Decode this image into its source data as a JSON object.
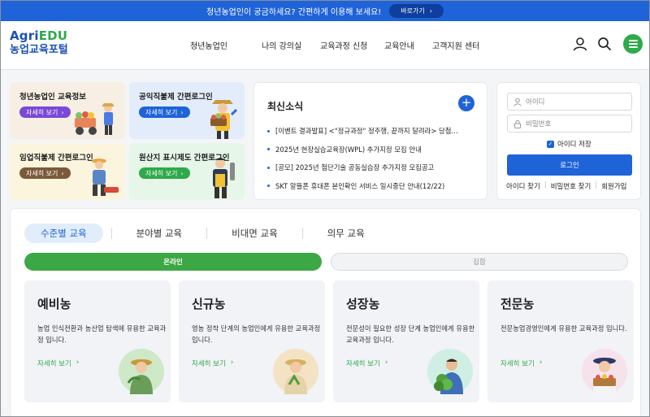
{
  "banner": {
    "text": "청년농업인이 궁금하세요? 간편하게 이용해 보세요!",
    "button": "바로가기",
    "button_icon": "chevron-right-icon"
  },
  "logo": {
    "line1_a": "Agri",
    "line1_b": "EDU",
    "line2": "농업교육포털"
  },
  "nav": [
    "청년농업인",
    "나의 강의실",
    "교육과정 신청",
    "교육안내",
    "고객지원 센터"
  ],
  "header_icons": [
    "user-icon",
    "search-icon",
    "menu-icon"
  ],
  "tiles": [
    {
      "title": "청년농업인 교육정보",
      "button": "자세히 보기",
      "bg": "#f7efe4",
      "btn_color": "#7a49d6"
    },
    {
      "title": "공익직불제 간편로그인",
      "button": "자세히 보기",
      "bg": "#e3ecfb",
      "btn_color": "#1f63d8"
    },
    {
      "title": "임업직불제 간편로그인",
      "button": "자세히 보기",
      "bg": "#fbf5dd",
      "btn_color": "#7b5a3a"
    },
    {
      "title": "원산지 표시제도 간편로그인",
      "button": "자세히 보기",
      "bg": "#e6f6e8",
      "btn_color": "#2eaa4a"
    }
  ],
  "news": {
    "title": "최신소식",
    "more": "+",
    "items": [
      "[이벤트 결과발표] <\"정규과정\" 정주행, 끝까지 달려라> 당첨…",
      "2025년 현장실습교육장(WPL) 추가지정 모집 안내",
      "[공모] 2025년 첨단기술 공동실습장 추가지정 모집공고",
      "SKT 알뜰폰 휴대폰 본인확인 서비스 일시중단 안내(12/22)"
    ]
  },
  "login": {
    "id_placeholder": "아이디",
    "pw_placeholder": "비밀번호",
    "save_id": "아이디 저장",
    "save_id_checked": true,
    "login_button": "로그인",
    "links": [
      "아이디 찾기",
      "비밀번호 찾기",
      "회원가입"
    ]
  },
  "courses": {
    "tabs": [
      "수준별 교육",
      "분야별 교육",
      "비대면 교육",
      "의무 교육"
    ],
    "active_tab": "수준별 교육",
    "modes": [
      "온라인",
      "집합"
    ],
    "active_mode": "온라인",
    "cards": [
      {
        "title": "예비농",
        "desc": "농업 인식전환과 농산업 탐색에 유용한 교육과정 입니다.",
        "more": "자세히 보기"
      },
      {
        "title": "신규농",
        "desc": "영농 정착 단계의 농업인에게 유용한 교육과정 입니다.",
        "more": "자세히 보기"
      },
      {
        "title": "성장농",
        "desc": "전문성이 필요한 성장 단계 농업인에게 유용한 교육과정 입니다.",
        "more": "자세히 보기"
      },
      {
        "title": "전문농",
        "desc": "전문농업경영인에게 유용한 교육과정 입니다.",
        "more": "자세히 보기"
      }
    ]
  },
  "colors": {
    "primary": "#1f63d8",
    "green": "#2eaa4a",
    "online_green": "#3ca845"
  }
}
